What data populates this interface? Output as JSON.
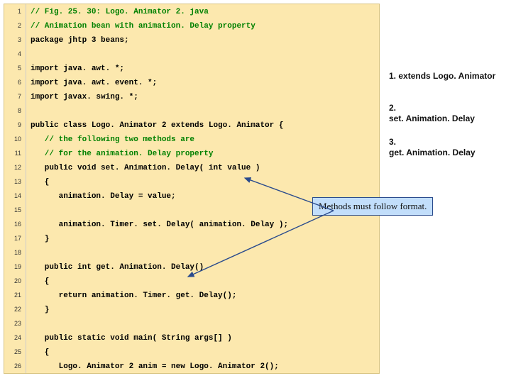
{
  "code_lines": [
    {
      "n": "1",
      "c": "// Fig. 25. 30: Logo. Animator 2. java"
    },
    {
      "n": "2",
      "c": "// Animation bean with animation. Delay property"
    },
    {
      "n": "3",
      "k": "package jhtp 3 beans;"
    },
    {
      "n": "4",
      "k": ""
    },
    {
      "n": "5",
      "k": "import java. awt. *;"
    },
    {
      "n": "6",
      "k": "import java. awt. event. *;"
    },
    {
      "n": "7",
      "k": "import javax. swing. *;"
    },
    {
      "n": "8",
      "k": ""
    },
    {
      "n": "9",
      "k": "public class Logo. Animator 2 extends Logo. Animator {"
    },
    {
      "n": "10",
      "c": "   // the following two methods are"
    },
    {
      "n": "11",
      "c": "   // for the animation. Delay property"
    },
    {
      "n": "12",
      "k": "   public void set. Animation. Delay( int value )"
    },
    {
      "n": "13",
      "k": "   {"
    },
    {
      "n": "14",
      "k": "      animation. Delay = value;"
    },
    {
      "n": "15",
      "k": ""
    },
    {
      "n": "16",
      "k": "      animation. Timer. set. Delay( animation. Delay );"
    },
    {
      "n": "17",
      "k": "   }"
    },
    {
      "n": "18",
      "k": ""
    },
    {
      "n": "19",
      "k": "   public int get. Animation. Delay()"
    },
    {
      "n": "20",
      "k": "   {"
    },
    {
      "n": "21",
      "k": "      return animation. Timer. get. Delay();"
    },
    {
      "n": "22",
      "k": "   }"
    },
    {
      "n": "23",
      "k": ""
    },
    {
      "n": "24",
      "k": "   public static void main( String args[] )"
    },
    {
      "n": "25",
      "k": "   {"
    },
    {
      "n": "26",
      "k": "      Logo. Animator 2 anim = new Logo. Animator 2();"
    }
  ],
  "notes": {
    "n1_num": "1.",
    "n1_kw": "extends Logo. Animator",
    "n2_num": "2.",
    "n2_kw": "set. Animation. Delay",
    "n3_num": "3.",
    "n3_kw": "get. Animation. Delay"
  },
  "callout": {
    "text": "Methods must follow format."
  }
}
